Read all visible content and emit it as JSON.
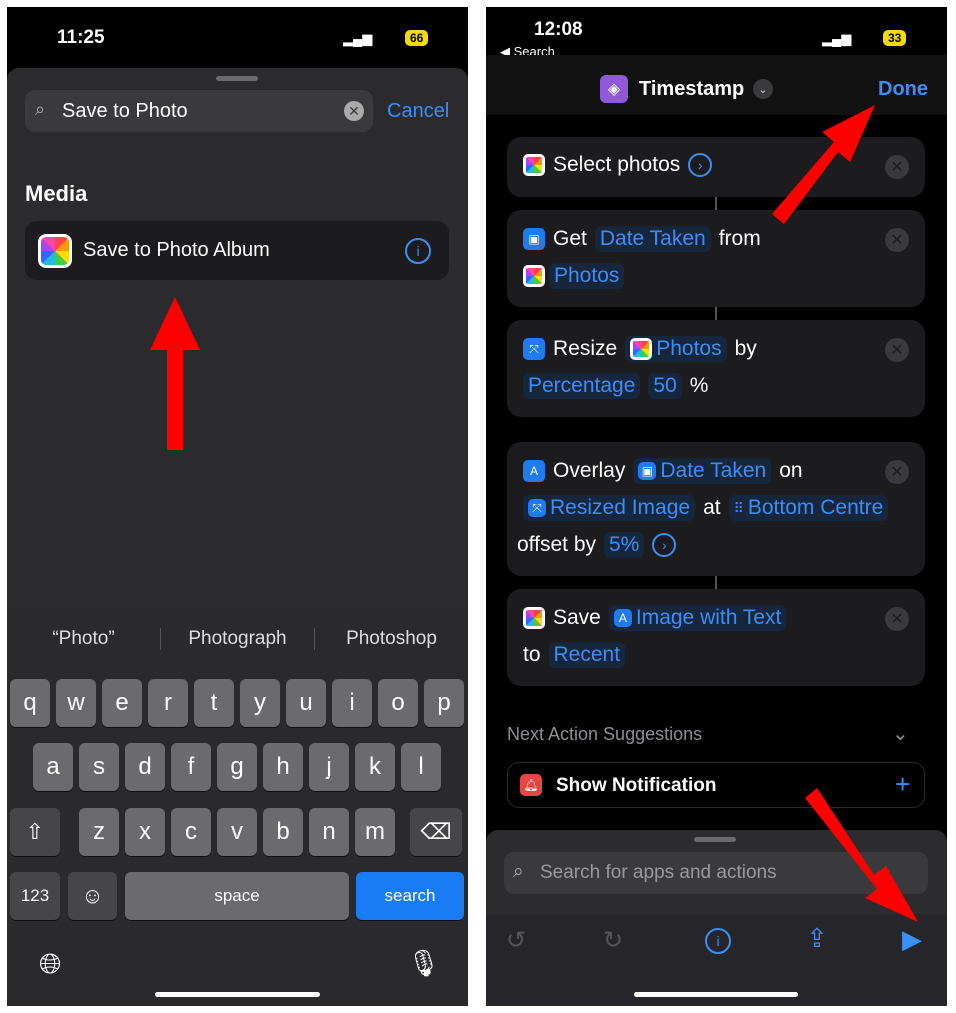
{
  "left": {
    "status": {
      "time": "11:25",
      "battery": "66"
    },
    "search": {
      "value": "Save to Photo",
      "cancel_label": "Cancel"
    },
    "section_title": "Media",
    "result": {
      "label": "Save to Photo Album",
      "icon": "photos-icon"
    },
    "suggestions": [
      "“Photo”",
      "Photograph",
      "Photoshop"
    ],
    "keyboard": {
      "row1": [
        "q",
        "w",
        "e",
        "r",
        "t",
        "y",
        "u",
        "i",
        "o",
        "p"
      ],
      "row2": [
        "a",
        "s",
        "d",
        "f",
        "g",
        "h",
        "j",
        "k",
        "l"
      ],
      "row3": [
        "z",
        "x",
        "c",
        "v",
        "b",
        "n",
        "m"
      ],
      "numbers_label": "123",
      "space_label": "space",
      "search_label": "search"
    }
  },
  "right": {
    "status": {
      "time": "12:08",
      "back_label": "◀ Search",
      "battery": "33"
    },
    "header": {
      "title": "Timestamp",
      "done_label": "Done"
    },
    "actions": {
      "select": {
        "label": "Select photos"
      },
      "get": {
        "verb": "Get",
        "param": "Date Taken",
        "from": "from",
        "source": "Photos"
      },
      "resize": {
        "verb": "Resize",
        "source": "Photos",
        "by": "by",
        "mode": "Percentage",
        "amount": "50",
        "unit": "%"
      },
      "overlay": {
        "verb": "Overlay",
        "text": "Date Taken",
        "on": "on",
        "image": "Resized Image",
        "at": "at",
        "position": "Bottom Centre",
        "offset": "offset by",
        "offset_value": "5%"
      },
      "save": {
        "verb": "Save",
        "image": "Image with Text",
        "to": "to",
        "album": "Recent"
      }
    },
    "suggestions_title": "Next Action Suggestions",
    "suggestion": {
      "label": "Show Notification"
    },
    "search_placeholder": "Search for apps and actions"
  },
  "colors": {
    "accent": "#3a8ef6",
    "annotation_arrow": "#ff0000",
    "battery": "#f5d90a"
  }
}
